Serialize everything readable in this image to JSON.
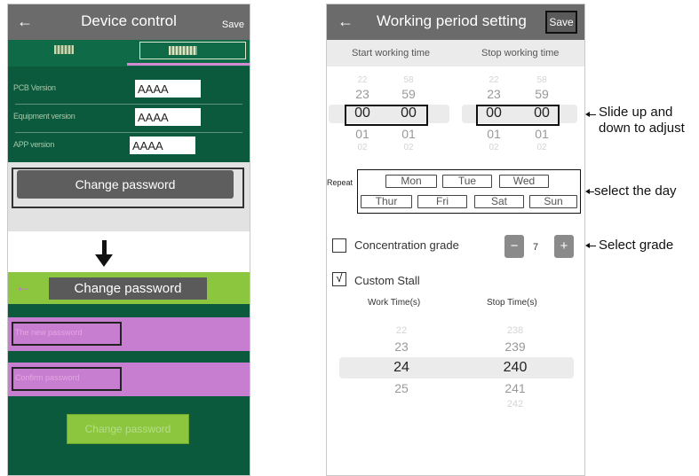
{
  "left": {
    "device_control": {
      "title": "Device control",
      "save": "Save",
      "rows": [
        {
          "label": "PCB Version",
          "value": "AAAA"
        },
        {
          "label": "Equipment version",
          "value": "AAAA"
        },
        {
          "label": "APP version",
          "value": "AAAA"
        }
      ],
      "change_password_button": "Change password"
    },
    "change_password": {
      "title": "Change password",
      "new_password_placeholder": "The new password",
      "confirm_password_placeholder": "Confirm password",
      "button": "Change password"
    }
  },
  "right": {
    "title": "Working period setting",
    "save": "Save",
    "start_label": "Start working time",
    "stop_label": "Stop working time",
    "start_hours": [
      "22",
      "23",
      "00",
      "01",
      "02"
    ],
    "start_minutes": [
      "58",
      "59",
      "00",
      "01",
      "02"
    ],
    "stop_hours": [
      "22",
      "23",
      "00",
      "01",
      "02"
    ],
    "stop_minutes": [
      "58",
      "59",
      "00",
      "01",
      "02"
    ],
    "repeat_label": "Repeat",
    "days": [
      "Mon",
      "Tue",
      "Wed",
      "Thur",
      "Fri",
      "Sat",
      "Sun"
    ],
    "concentration_label": "Concentration grade",
    "grade_value": "7",
    "minus": "−",
    "plus": "+",
    "custom_stall_label": "Custom  Stall",
    "custom_checked_mark": "√",
    "work_time_label": "Work Time(s)",
    "stop_time_label": "Stop Time(s)",
    "work_times": [
      "22",
      "23",
      "24",
      "25"
    ],
    "stop_times": [
      "238",
      "239",
      "240",
      "241",
      "242"
    ]
  },
  "annotations": {
    "slide_line1": "Slide up and",
    "slide_line2": "down to adjust",
    "select_day": "select the day",
    "select_grade": "Select grade"
  }
}
